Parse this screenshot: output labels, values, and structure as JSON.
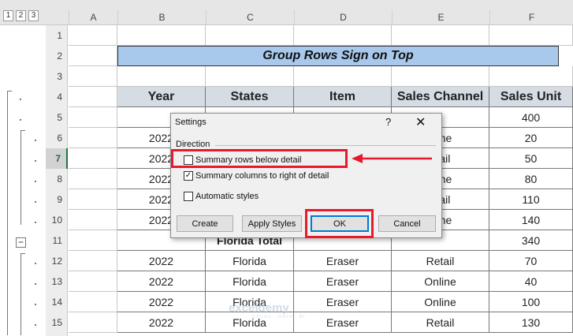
{
  "outline_levels": [
    "1",
    "2",
    "3"
  ],
  "columns": [
    "A",
    "B",
    "C",
    "D",
    "E",
    "F"
  ],
  "row_numbers": [
    "1",
    "2",
    "3",
    "4",
    "5",
    "6",
    "7",
    "8",
    "9",
    "10",
    "11",
    "12",
    "13",
    "14",
    "15"
  ],
  "active_row": "7",
  "outline_minus": "−",
  "title": "Group Rows Sign on Top",
  "table_headers": [
    "Year",
    "States",
    "Item",
    "Sales Channel",
    "Sales Unit"
  ],
  "rows": [
    [
      "",
      "",
      "",
      "",
      "400"
    ],
    [
      "2022",
      "",
      "",
      "nline",
      "20"
    ],
    [
      "2022",
      "",
      "",
      "etail",
      "50"
    ],
    [
      "2022",
      "",
      "",
      "nline",
      "80"
    ],
    [
      "2022",
      "",
      "",
      "etail",
      "110"
    ],
    [
      "2022",
      "",
      "",
      "nline",
      "140"
    ],
    [
      "",
      "Florida Total",
      "",
      "",
      "340"
    ],
    [
      "2022",
      "Florida",
      "Eraser",
      "Retail",
      "70"
    ],
    [
      "2022",
      "Florida",
      "Eraser",
      "Online",
      "40"
    ],
    [
      "2022",
      "Florida",
      "Eraser",
      "Online",
      "100"
    ],
    [
      "2022",
      "Florida",
      "Eraser",
      "Retail",
      "130"
    ]
  ],
  "dialog": {
    "title": "Settings",
    "help": "?",
    "close": "✕",
    "group_label": "Direction",
    "opt_rows": "Summary rows below detail",
    "opt_cols": "Summary columns to right of detail",
    "opt_auto": "Automatic styles",
    "btn_create": "Create",
    "btn_apply": "Apply Styles",
    "btn_ok": "OK",
    "btn_cancel": "Cancel",
    "rows_checked": false,
    "cols_checked": true,
    "auto_checked": false
  },
  "watermark": "exceldemy",
  "watermark_sub": "EXCEL · DATA · BI",
  "colors": {
    "header_fill": "#d6dce4",
    "title_fill": "#a8c8ec",
    "annotation": "#e8192c",
    "ok_focus": "#0078d7"
  }
}
